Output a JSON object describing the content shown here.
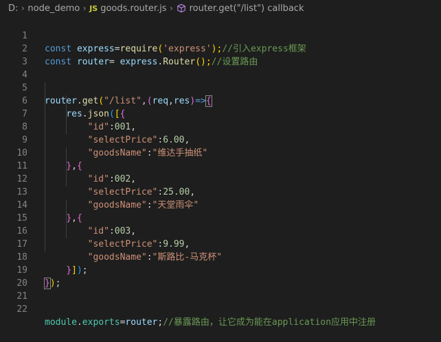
{
  "breadcrumb": {
    "drive": "D:",
    "folder": "node_demo",
    "file_badge": "JS",
    "file": "goods.router.js",
    "symbol": "router.get(\"/list\") callback"
  },
  "colors": {
    "background": "#1e1e1e",
    "keyword": "#569cd6",
    "variable": "#9cdcfe",
    "function": "#dcdcaa",
    "string": "#ce9178",
    "number": "#b5cea8",
    "comment": "#6a9955",
    "line_number": "#858585"
  },
  "icons": {
    "separator": "chevron-right-icon",
    "symbol": "method-cube-icon"
  },
  "editor": {
    "line_numbers": [
      "1",
      "2",
      "3",
      "4",
      "5",
      "6",
      "7",
      "8",
      "9",
      "10",
      "11",
      "12",
      "13",
      "14",
      "15",
      "16",
      "17",
      "18",
      "19",
      "20",
      "21",
      "22"
    ],
    "lines": {
      "l1": {
        "kw": "const",
        "var": "express",
        "eq": "=",
        "fn": "require",
        "p1": "(",
        "str": "'express'",
        "p2": ");",
        "cm": "//引入express框架"
      },
      "l2": {
        "kw": "const",
        "var": "router",
        "eq": "=",
        "obj": "express",
        "dot": ".",
        "fn": "Router",
        "p": "();",
        "cm": "//设置路由"
      },
      "l5": {
        "obj": "router",
        "dot": ".",
        "fn": "get",
        "p1": "(",
        "str": "\"/list\"",
        "comma": ",",
        "p2": "(",
        "a1": "req",
        "c2": ",",
        "a2": "res",
        "p3": ")",
        "arrow": "=>",
        "brace": "{"
      },
      "l6": {
        "obj": "res",
        "dot": ".",
        "fn": "json",
        "p": "(",
        "b": "[",
        "c": "{"
      },
      "l7": {
        "key": "\"id\"",
        "colon": ":",
        "num": "001",
        "comma": ","
      },
      "l8": {
        "key": "\"selectPrice\"",
        "colon": ":",
        "num": "6.00",
        "comma": ","
      },
      "l9": {
        "key": "\"goodsName\"",
        "colon": ":",
        "str": "\"维达手抽纸\""
      },
      "l10": {
        "close": "}",
        "comma": ",",
        "open": "{"
      },
      "l11": {
        "key": "\"id\"",
        "colon": ":",
        "num": "002",
        "comma": ","
      },
      "l12": {
        "key": "\"selectPrice\"",
        "colon": ":",
        "num": "25.00",
        "comma": ","
      },
      "l13": {
        "key": "\"goodsName\"",
        "colon": ":",
        "str": "\"天堂雨伞\""
      },
      "l14": {
        "close": "}",
        "comma": ",",
        "open": "{"
      },
      "l15": {
        "key": "\"id\"",
        "colon": ":",
        "num": "003",
        "comma": ","
      },
      "l16": {
        "key": "\"selectPrice\"",
        "colon": ":",
        "num": "9.99",
        "comma": ","
      },
      "l17": {
        "key": "\"goodsName\"",
        "colon": ":",
        "str": "\"斯路比-马克杯\""
      },
      "l18": {
        "c": "}",
        "b": "]",
        "p": ")",
        "semi": ";"
      },
      "l19": {
        "brace": "}",
        "p": ")",
        "semi": ";"
      },
      "l22": {
        "obj": "module",
        "dot": ".",
        "prop": "exports",
        "eq": "=",
        "var": "router",
        "semi": ";",
        "cm": "//暴露路由，让它成为能在application应用中注册"
      }
    }
  }
}
